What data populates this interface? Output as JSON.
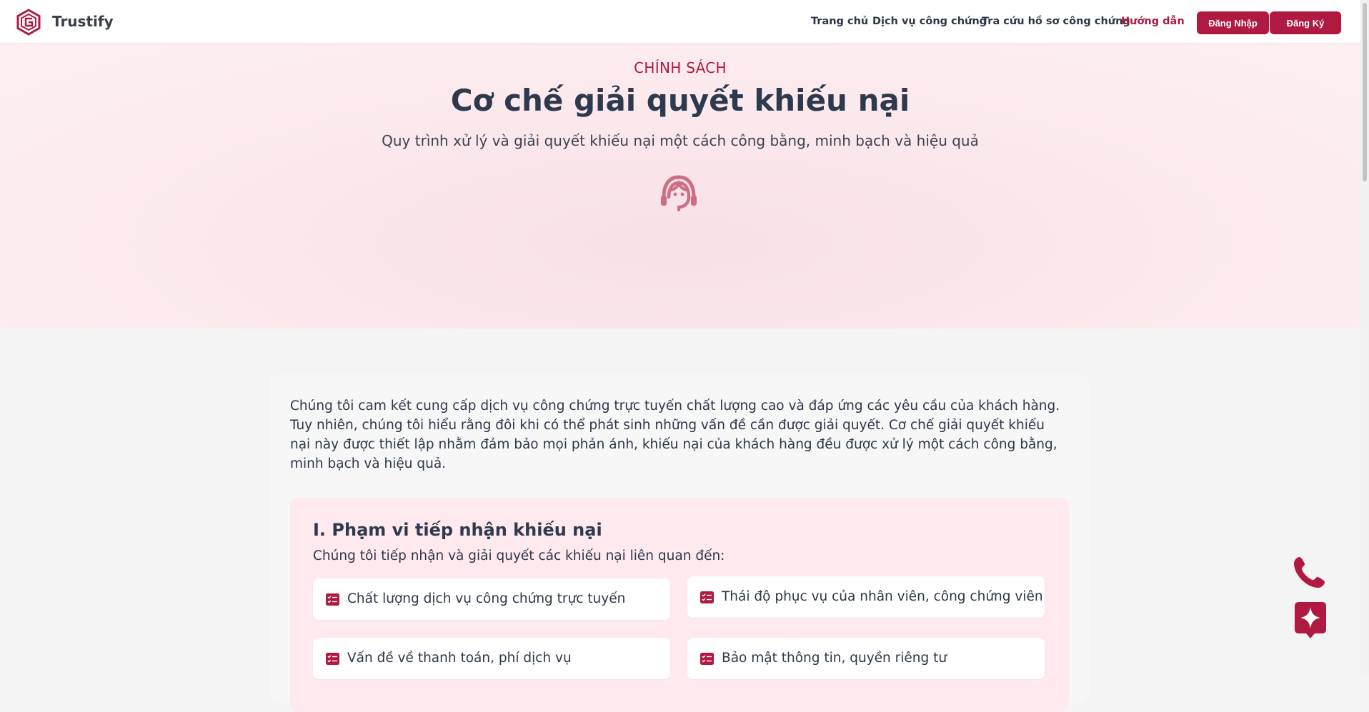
{
  "header": {
    "brand": "Trustify",
    "nav": [
      "Trang chủ",
      "Dịch vụ công chứng",
      "Tra cứu hồ sơ công chứng",
      "Hướng dẫn"
    ],
    "login_label": "Đăng Nhập",
    "register_label": "Đăng Ký"
  },
  "hero": {
    "eyebrow": "CHÍNH SÁCH",
    "title": "Cơ chế giải quyết khiếu nại",
    "subtitle": "Quy trình xử lý và giải quyết khiếu nại một cách công bằng, minh bạch và hiệu quả",
    "icon": "headset-support-icon"
  },
  "intro": "Chúng tôi cam kết cung cấp dịch vụ công chứng trực tuyến chất lượng cao và đáp ứng các yêu cầu của khách hàng. Tuy nhiên, chúng tôi hiểu rằng đôi khi có thể phát sinh những vấn đề cần được giải quyết. Cơ chế giải quyết khiếu nại này được thiết lập nhằm đảm bảo mọi phản ánh, khiếu nại của khách hàng đều được xử lý một cách công bằng, minh bạch và hiệu quả.",
  "section1": {
    "title": "I. Phạm vi tiếp nhận khiếu nại",
    "description": "Chúng tôi tiếp nhận và giải quyết các khiếu nại liên quan đến:",
    "items": [
      "Chất lượng dịch vụ công chứng trực tuyến",
      "Thái độ phục vụ của nhân viên, công chứng viên",
      "Vấn đề về thanh toán, phí dịch vụ",
      "Bảo mật thông tin, quyền riêng tư"
    ]
  },
  "colors": {
    "accent": "#b01a40",
    "hero_bg": "#fbe8ec",
    "section_bg": "#fde9ee"
  }
}
